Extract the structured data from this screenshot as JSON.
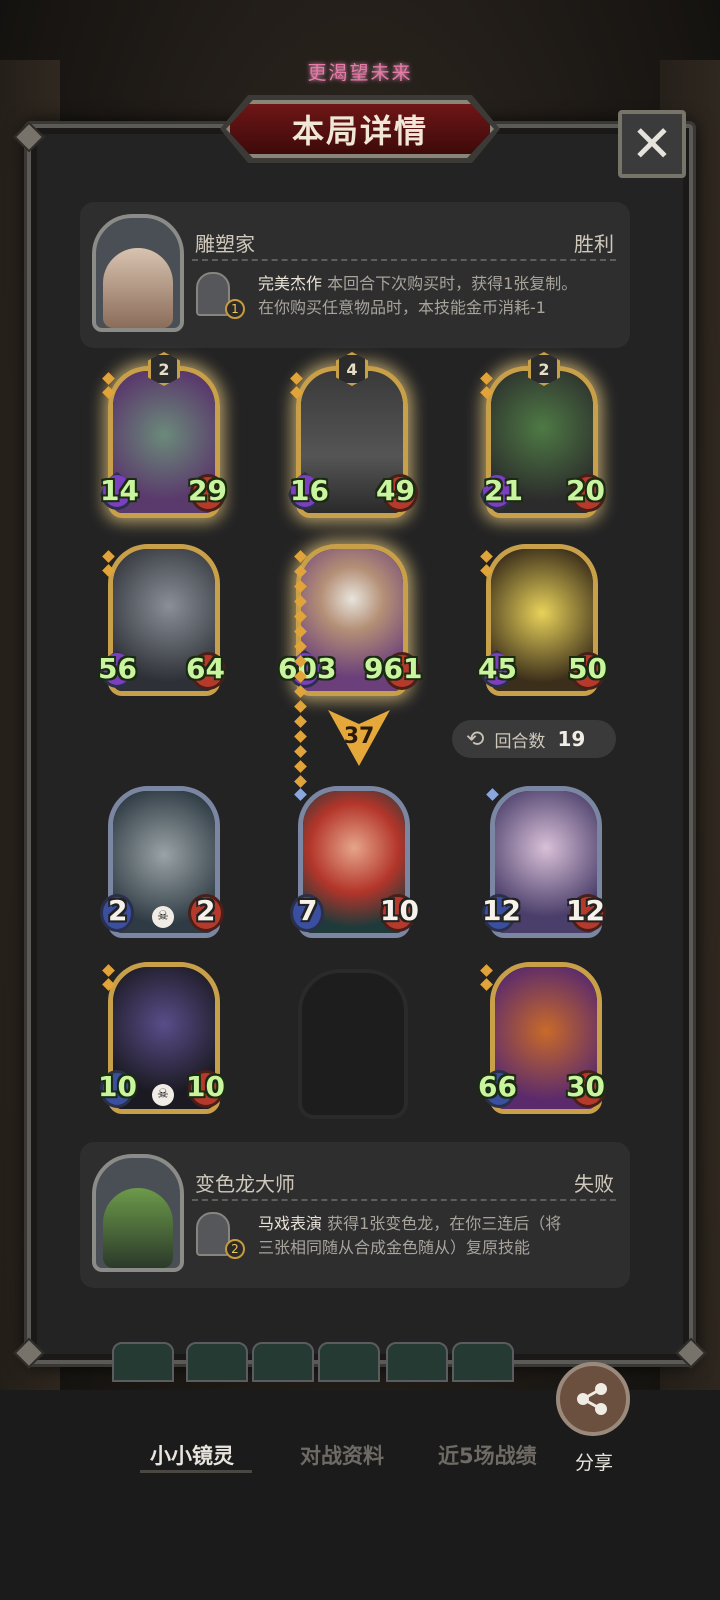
{
  "top_title": "更渴望未来",
  "modal": {
    "title": "本局详情",
    "close_glyph": "✕"
  },
  "player": {
    "name": "雕塑家",
    "result": "胜利",
    "skill_name": "完美杰作",
    "skill_desc_1": "本回合下次购买时，获得1张复制。",
    "skill_desc_2": "在你购买任意物品时，本技能金币消耗-1",
    "skill_cost": "1"
  },
  "opponent": {
    "name": "变色龙大师",
    "result": "失败",
    "skill_name": "马戏表演",
    "skill_desc_1": "获得1张变色龙，在你三连后（将",
    "skill_desc_2": "三张相同随从合成金色随从）复原技能",
    "skill_cost": "2"
  },
  "player_units": [
    {
      "tier": "2",
      "atk": "14",
      "hp": "29"
    },
    {
      "tier": "4",
      "atk": "16",
      "hp": "49"
    },
    {
      "tier": "2",
      "atk": "21",
      "hp": "20"
    },
    {
      "atk": "56",
      "hp": "64"
    },
    {
      "atk": "603",
      "hp": "961"
    },
    {
      "atk": "45",
      "hp": "50"
    }
  ],
  "damage": "37",
  "rounds": {
    "label": "回合数",
    "value": "19"
  },
  "opponent_units": [
    {
      "atk": "2",
      "hp": "2"
    },
    {
      "atk": "7",
      "hp": "10"
    },
    {
      "atk": "12",
      "hp": "12"
    },
    {
      "atk": "10",
      "hp": "10"
    },
    {
      "atk": "66",
      "hp": "30"
    }
  ],
  "tabs": [
    "小小镜灵",
    "对战资料",
    "近5场战绩"
  ],
  "share_label": "分享",
  "icons": {
    "close": "close-icon",
    "share": "share-icon",
    "rounds": "refresh-icon"
  },
  "colors": {
    "gold": "#c9a04a",
    "stat_green": "#c9f59e",
    "banner_red": "#6e1616"
  }
}
